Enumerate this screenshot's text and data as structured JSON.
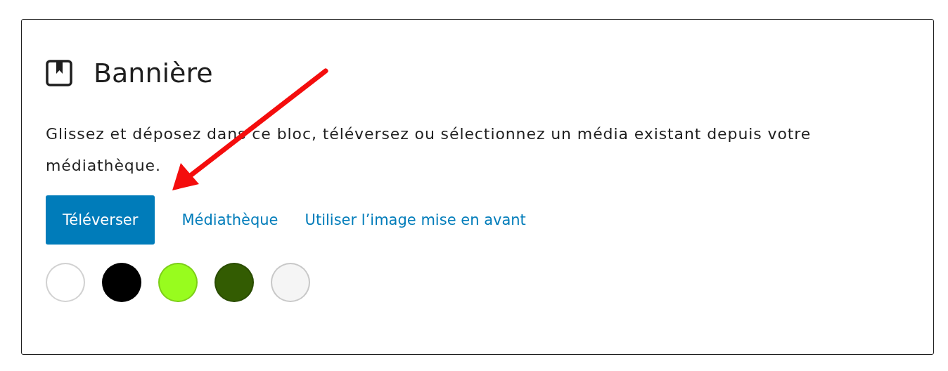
{
  "block": {
    "title": "Bannière",
    "instructions": "Glissez et déposez dans ce bloc, téléversez ou sélectionnez un média existant depuis votre médiathèque.",
    "actions": [
      {
        "kind": "primary",
        "label": "Téléverser"
      },
      {
        "kind": "link",
        "label": "Médiathèque"
      },
      {
        "kind": "link",
        "label": "Utiliser l’image mise en avant"
      }
    ],
    "swatches": [
      {
        "color": "#ffffff"
      },
      {
        "color": "#000000"
      },
      {
        "color": "#98fc1e"
      },
      {
        "color": "#335c02"
      },
      {
        "color": "#f5f5f5"
      }
    ]
  }
}
